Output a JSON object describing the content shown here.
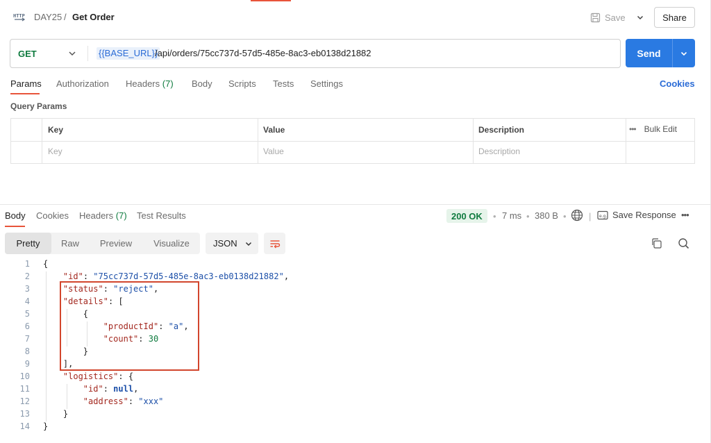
{
  "header": {
    "breadcrumb_parent": "DAY25",
    "breadcrumb_sep": "/",
    "request_name": "Get Order",
    "save_label": "Save",
    "share_label": "Share"
  },
  "request": {
    "method": "GET",
    "url_variable": "{{BASE_URL}}",
    "url_path": "/api/orders/75cc737d-57d5-485e-8ac3-eb0138d21882",
    "send_label": "Send",
    "tabs": [
      {
        "label": "Params"
      },
      {
        "label": "Authorization"
      },
      {
        "label": "Headers",
        "count": "(7)"
      },
      {
        "label": "Body"
      },
      {
        "label": "Scripts"
      },
      {
        "label": "Tests"
      },
      {
        "label": "Settings"
      }
    ],
    "cookies_label": "Cookies",
    "query_params_title": "Query Params",
    "params_table": {
      "headers": [
        "Key",
        "Value",
        "Description"
      ],
      "placeholders": [
        "Key",
        "Value",
        "Description"
      ],
      "bulk_edit_label": "Bulk Edit"
    }
  },
  "response": {
    "tabs": [
      {
        "label": "Body"
      },
      {
        "label": "Cookies"
      },
      {
        "label": "Headers",
        "count": "(7)"
      },
      {
        "label": "Test Results"
      }
    ],
    "status": "200 OK",
    "time": "7 ms",
    "size": "380 B",
    "save_response_label": "Save Response",
    "view_modes": [
      "Pretty",
      "Raw",
      "Preview",
      "Visualize"
    ],
    "format": "JSON",
    "line_numbers": [
      "1",
      "2",
      "3",
      "4",
      "5",
      "6",
      "7",
      "8",
      "9",
      "10",
      "11",
      "12",
      "13",
      "14"
    ],
    "body": {
      "open": "{",
      "id_key": "\"id\"",
      "id_val": "\"75cc737d-57d5-485e-8ac3-eb0138d21882\"",
      "status_key": "\"status\"",
      "status_val": "\"reject\"",
      "details_key": "\"details\"",
      "productId_key": "\"productId\"",
      "productId_val": "\"a\"",
      "count_key": "\"count\"",
      "count_val": "30",
      "logistics_key": "\"logistics\"",
      "logistics_id_key": "\"id\"",
      "logistics_id_val": "null",
      "address_key": "\"address\"",
      "address_val": "\"xxx\"",
      "close": "}"
    }
  },
  "colors": {
    "accent": "#e8543a",
    "send": "#2a7ae2",
    "status_ok": "#0f7b3f",
    "highlight": "#d2452c"
  }
}
